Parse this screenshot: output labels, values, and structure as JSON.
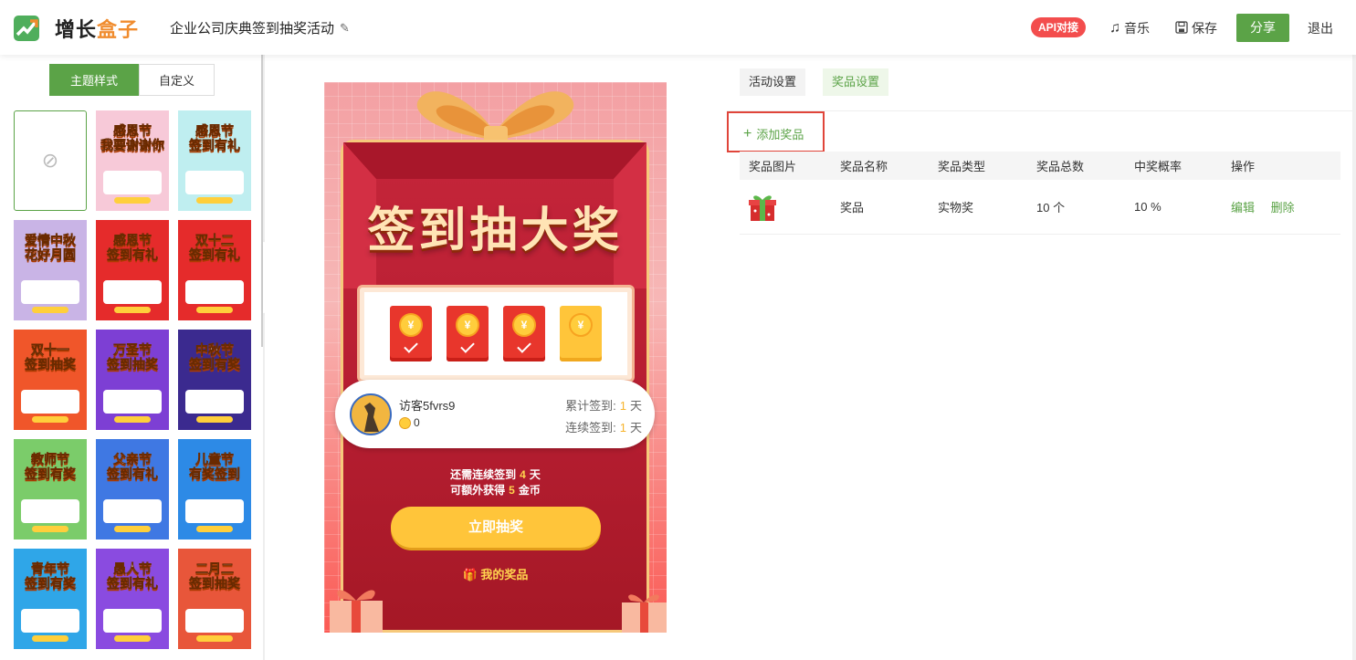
{
  "header": {
    "logo_text_a": "增长",
    "logo_text_b": "盒子",
    "activity_title": "企业公司庆典签到抽奖活动",
    "api_badge": "API对接",
    "music_label": "音乐",
    "save_label": "保存",
    "share_label": "分享",
    "exit_label": "退出"
  },
  "left": {
    "tab_theme": "主题样式",
    "tab_custom": "自定义",
    "thumbnails": [
      {
        "title": "",
        "bg": "#ffffff",
        "selected": true
      },
      {
        "title": "感恩节\n我要谢谢你",
        "bg": "#f7c9d8"
      },
      {
        "title": "感恩节\n签到有礼",
        "bg": "#bfeef0"
      },
      {
        "title": "爱情中秋\n花好月圆",
        "bg": "#c9b4e6"
      },
      {
        "title": "感恩节\n签到有礼",
        "bg": "#e52b2b"
      },
      {
        "title": "双十二\n签到有礼",
        "bg": "#e52b2b"
      },
      {
        "title": "双十一\n签到抽奖",
        "bg": "#f0562a"
      },
      {
        "title": "万圣节\n签到抽奖",
        "bg": "#7d3fd4"
      },
      {
        "title": "中秋节\n签到有奖",
        "bg": "#3b2a8f"
      },
      {
        "title": "教师节\n签到有奖",
        "bg": "#7bcc6a"
      },
      {
        "title": "父亲节\n签到有礼",
        "bg": "#3f78e3"
      },
      {
        "title": "儿童节\n有奖签到",
        "bg": "#2d8ae6"
      },
      {
        "title": "青年节\n签到有奖",
        "bg": "#2fa6e8"
      },
      {
        "title": "愚人节\n签到有礼",
        "bg": "#8a4be0"
      },
      {
        "title": "二月二\n签到抽奖",
        "bg": "#e8563a"
      }
    ]
  },
  "preview": {
    "big_title": "签到抽大奖",
    "envelopes": [
      {
        "opened": true,
        "coin": "¥"
      },
      {
        "opened": true,
        "coin": "¥"
      },
      {
        "opened": true,
        "coin": "¥"
      },
      {
        "opened": false,
        "coin": "¥"
      }
    ],
    "user_name": "访客5fvrs9",
    "user_coins": "0",
    "total_label_a": "累计签到:",
    "total_value": "1",
    "total_unit": "天",
    "streak_label_a": "连续签到:",
    "streak_value": "1",
    "streak_unit": "天",
    "need_prefix": "还需连续签到",
    "need_days": "4",
    "need_suffix": "天",
    "extra_prefix": "可额外获得",
    "extra_coins": "5",
    "extra_suffix": "金币",
    "draw_button": "立即抽奖",
    "my_prize": "我的奖品"
  },
  "right": {
    "tab_activity": "活动设置",
    "tab_prize": "奖品设置",
    "add_prize": "添加奖品",
    "columns": [
      "奖品图片",
      "奖品名称",
      "奖品类型",
      "奖品总数",
      "中奖概率",
      "操作"
    ],
    "rows": [
      {
        "name": "奖品",
        "type": "实物奖",
        "total": "10 个",
        "prob": "10 %",
        "edit": "编辑",
        "delete": "删除"
      }
    ]
  },
  "colors": {
    "accent": "#5ba347",
    "api_red": "#f34d4d",
    "highlight_border": "#e0453a"
  }
}
